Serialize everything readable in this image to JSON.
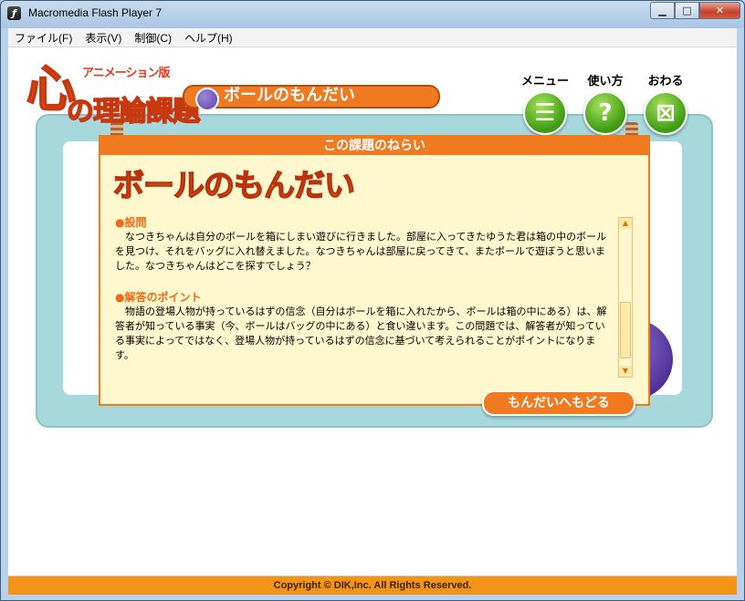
{
  "window": {
    "title": "Macromedia Flash Player 7",
    "app_icon": "flash-icon"
  },
  "menubar": {
    "items": [
      "ファイル(F)",
      "表示(V)",
      "制御(C)",
      "ヘルプ(H)"
    ]
  },
  "app": {
    "logo_sub": "アニメーション版",
    "logo_kokoro": "心",
    "logo_main": "の理論課題",
    "page_title": "ボールのもんだい",
    "nav": [
      {
        "label": "メニュー",
        "icon": "menu-icon"
      },
      {
        "label": "使い方",
        "icon": "question-icon"
      },
      {
        "label": "おわる",
        "icon": "close-icon"
      }
    ]
  },
  "panel": {
    "header": "この課題のねらい",
    "heading": "ボールのもんだい",
    "sections": [
      {
        "title": "●設問",
        "body": "なつきちゃんは自分のボールを箱にしまい遊びに行きました。部屋に入ってきたゆうた君は箱の中のボールを見つけ、それをバッグに入れ替えました。なつきちゃんは部屋に戻ってきて、またボールで遊ぼうと思いました。なつきちゃんはどこを探すでしょう？"
      },
      {
        "title": "●解答のポイント",
        "body": "物語の登場人物が持っているはずの信念（自分はボールを箱に入れたから、ボールは箱の中にある）は、解答者が知っている事実（今、ボールはバッグの中にある）と食い違います。この問題では、解答者が知っている事実によってではなく、登場人物が持っているはずの信念に基づいて考えられることがポイントになります。"
      }
    ],
    "back_button": "もんだいへもどる"
  },
  "footer": {
    "copyright": "Copyright © DIK,Inc. All Rights Reserved."
  },
  "colors": {
    "accent": "#f07a20",
    "panel_bg": "#fff8cf",
    "teal": "#a6d8dc",
    "footer": "#f29418"
  }
}
